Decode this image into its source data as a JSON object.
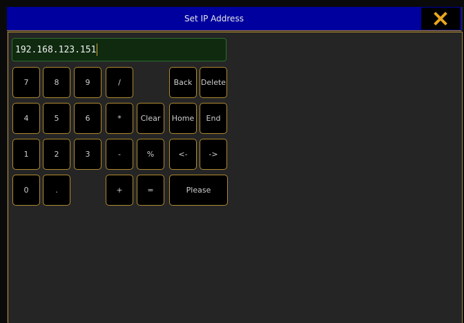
{
  "dialog": {
    "title": "Set IP Address",
    "close_icon": "close-x-icon",
    "accent_color": "#d4a93a"
  },
  "input": {
    "value": "192.168.123.151"
  },
  "keys": {
    "k7": "7",
    "k8": "8",
    "k9": "9",
    "slash": "/",
    "back": "Back",
    "delete": "Delete",
    "k4": "4",
    "k5": "5",
    "k6": "6",
    "asterisk": "*",
    "clear": "Clear",
    "home": "Home",
    "end": "End",
    "k1": "1",
    "k2": "2",
    "k3": "3",
    "minus": "-",
    "percent": "%",
    "left": "<-",
    "right": "->",
    "k0": "0",
    "dot": ".",
    "plus": "+",
    "equals": "=",
    "please": "Please"
  }
}
